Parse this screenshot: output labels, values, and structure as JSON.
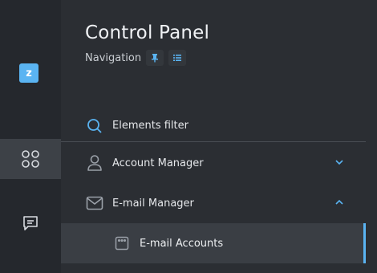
{
  "rail": {
    "logo_letter": "z",
    "items": [
      {
        "icon": "apps-grid-icon"
      },
      {
        "icon": "chat-icon"
      }
    ]
  },
  "panel": {
    "title": "Control Panel",
    "subtitle": "Navigation",
    "filter": {
      "label": "Elements filter"
    },
    "nav": [
      {
        "label": "Account Manager",
        "icon": "user-icon",
        "expanded": false
      },
      {
        "label": "E-mail Manager",
        "icon": "envelope-icon",
        "expanded": true,
        "children": [
          {
            "label": "E-mail Accounts",
            "icon": "account-card-icon",
            "active": true
          }
        ]
      }
    ]
  },
  "colors": {
    "accent": "#5ab4f2",
    "rail_bg": "#25282d",
    "panel_bg": "#2b2e33",
    "active_bg": "#3a3e44"
  }
}
